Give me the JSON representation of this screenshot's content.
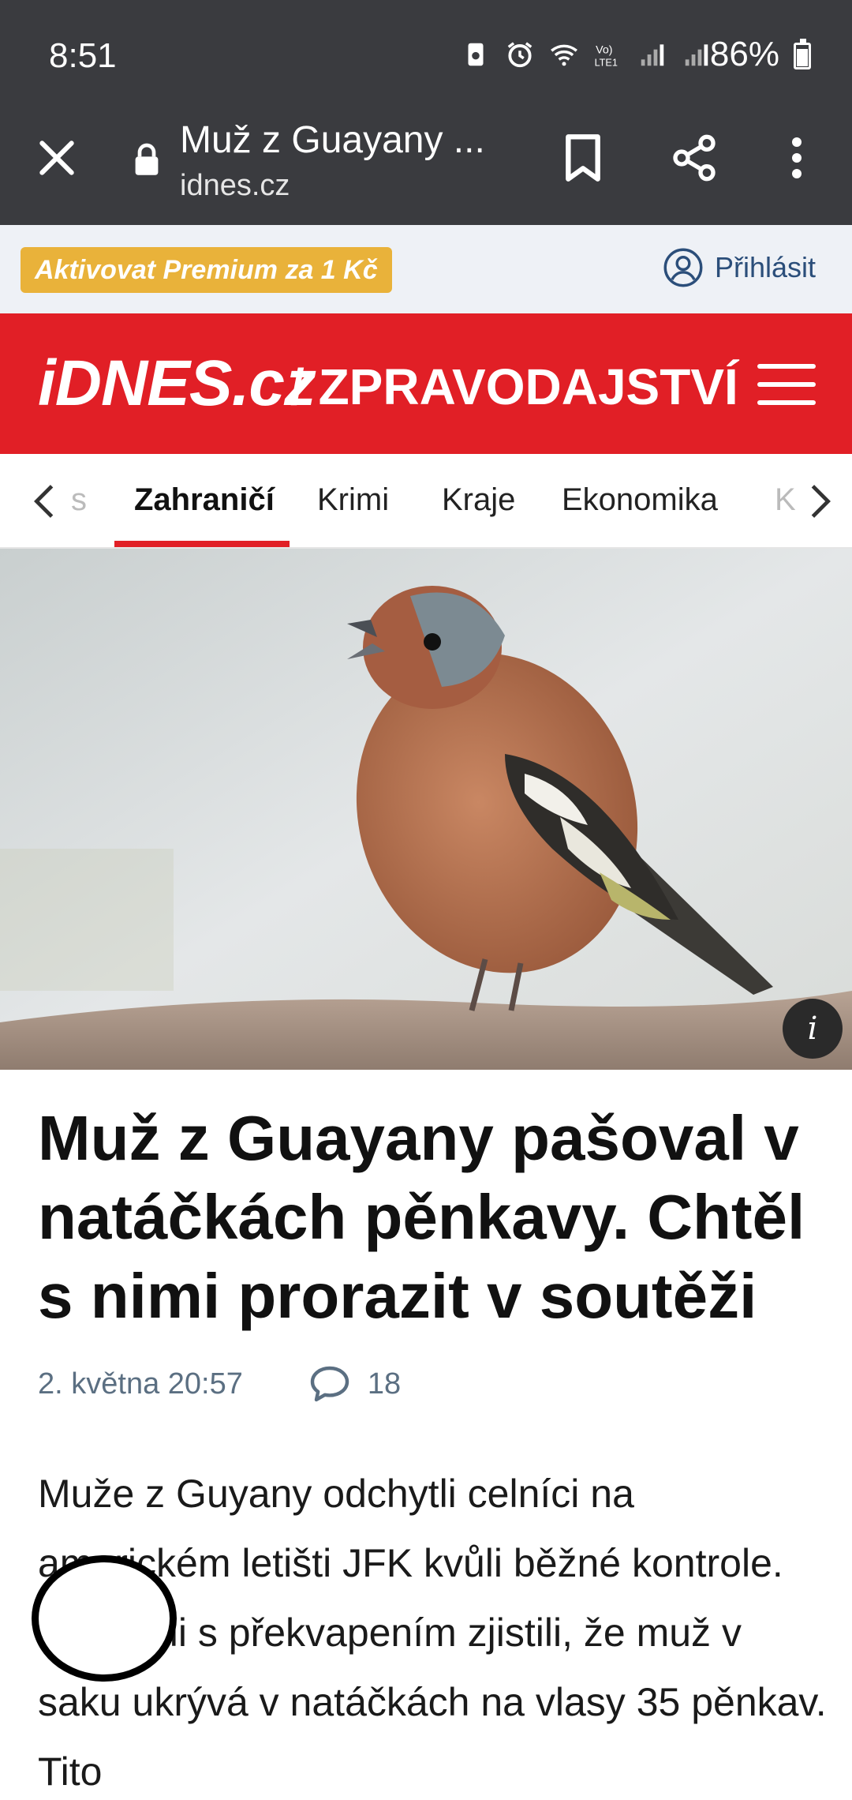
{
  "status_bar": {
    "time": "8:51",
    "battery": "86%",
    "icons": [
      "battery-saver-icon",
      "alarm-icon",
      "wifi-icon",
      "volte-icon",
      "signal-icon",
      "signal-icon"
    ]
  },
  "browser": {
    "page_title": "Muž z Guayany ...",
    "host": "idnes.cz"
  },
  "premium": {
    "button_label": "Aktivovat Premium za 1 Kč",
    "login_label": "Přihlásit"
  },
  "header": {
    "logo": "iDNES.cz",
    "section": "/ ZPRAVODAJSTVÍ"
  },
  "tabs": {
    "items": [
      {
        "label": "s"
      },
      {
        "label": "Zahraničí"
      },
      {
        "label": "Krimi"
      },
      {
        "label": "Kraje"
      },
      {
        "label": "Ekonomika"
      },
      {
        "label": "K"
      }
    ],
    "active": "Zahraničí"
  },
  "article": {
    "headline": "Muž z Guayany pašoval v natáčkách pěnkavy. Chtěl s nimi prorazit v soutěži",
    "date": "2. května 20:57",
    "comments": "18",
    "perex": "Muže z Guyany odchytli celníci na americkém letišti JFK kvůli běžné kontrole. Po chvíli s překvapením zjistili, že muž v saku ukrývá v natáčkách na vlasy 35 pěnkav. Tito",
    "image_info": "i"
  },
  "colors": {
    "chrome": "#3a3b3f",
    "brand_red": "#e11f26",
    "premium": "#e9b23a",
    "login_text": "#2b4e7a"
  }
}
